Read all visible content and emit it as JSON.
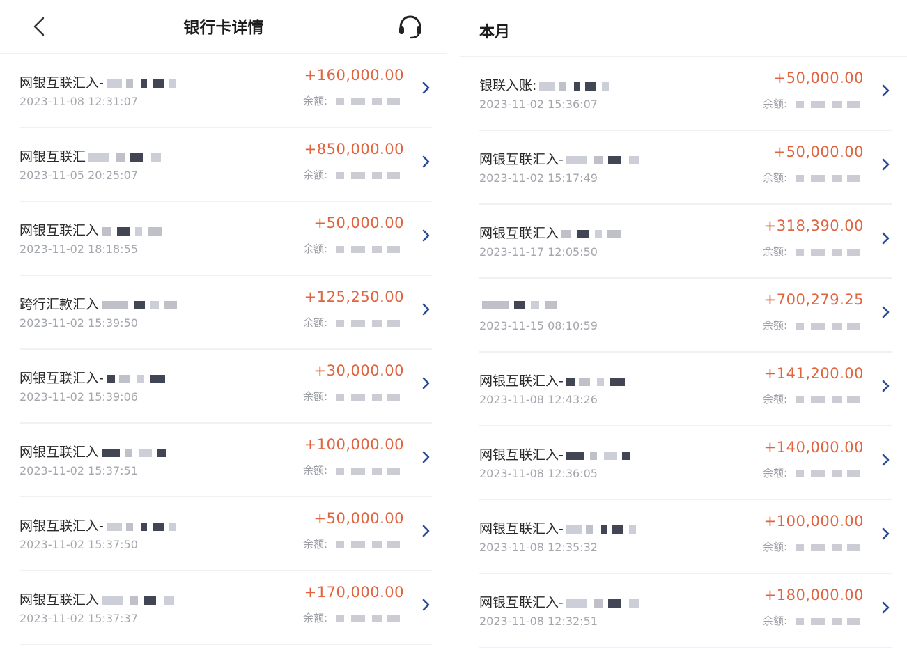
{
  "left": {
    "title": "银行卡详情",
    "transactions": [
      {
        "desc": "网银互联汇入-",
        "time": "2023-11-08 12:31:07",
        "amount": "+160,000.00",
        "balance_label": "余额:"
      },
      {
        "desc": "网银互联汇",
        "time": "2023-11-05 20:25:07",
        "amount": "+850,000.00",
        "balance_label": "余额:"
      },
      {
        "desc": "网银互联汇入",
        "time": "2023-11-02 18:18:55",
        "amount": "+50,000.00",
        "balance_label": "余额:"
      },
      {
        "desc": "跨行汇款汇入",
        "time": "2023-11-02 15:39:50",
        "amount": "+125,250.00",
        "balance_label": "余额:"
      },
      {
        "desc": "网银互联汇入-",
        "time": "2023-11-02 15:39:06",
        "amount": "+30,000.00",
        "balance_label": "余额:"
      },
      {
        "desc": "网银互联汇入",
        "time": "2023-11-02 15:37:51",
        "amount": "+100,000.00",
        "balance_label": "余额:"
      },
      {
        "desc": "网银互联汇入-",
        "time": "2023-11-02 15:37:50",
        "amount": "+50,000.00",
        "balance_label": "余额:"
      },
      {
        "desc": "网银互联汇入",
        "time": "2023-11-02 15:37:37",
        "amount": "+170,000.00",
        "balance_label": "余额:"
      }
    ]
  },
  "right": {
    "section_title": "本月",
    "transactions": [
      {
        "desc": "银联入账:",
        "time": "2023-11-02 15:36:07",
        "amount": "+50,000.00",
        "balance_label": "余额:"
      },
      {
        "desc": "网银互联汇入-",
        "time": "2023-11-02 15:17:49",
        "amount": "+50,000.00",
        "balance_label": "余额:"
      },
      {
        "desc": "网银互联汇入",
        "time": "2023-11-17 12:05:50",
        "amount": "+318,390.00",
        "balance_label": "余额:"
      },
      {
        "desc": "",
        "time": "2023-11-15 08:10:59",
        "amount": "+700,279.25",
        "balance_label": "余额:"
      },
      {
        "desc": "网银互联汇入-",
        "time": "2023-11-08 12:43:26",
        "amount": "+141,200.00",
        "balance_label": "余额:"
      },
      {
        "desc": "网银互联汇入-",
        "time": "2023-11-08 12:36:05",
        "amount": "+140,000.00",
        "balance_label": "余额:"
      },
      {
        "desc": "网银互联汇入-",
        "time": "2023-11-08 12:35:32",
        "amount": "+100,000.00",
        "balance_label": "余额:"
      },
      {
        "desc": "网银互联汇入-",
        "time": "2023-11-08 12:32:51",
        "amount": "+180,000.00",
        "balance_label": "余额:"
      }
    ]
  },
  "colors": {
    "amount": "#e0643f",
    "chevron": "#2b4a9a",
    "divider": "#f1f1f3"
  },
  "icons": {
    "back": "chevron-left-icon",
    "service": "headset-icon",
    "row": "chevron-right-icon"
  }
}
